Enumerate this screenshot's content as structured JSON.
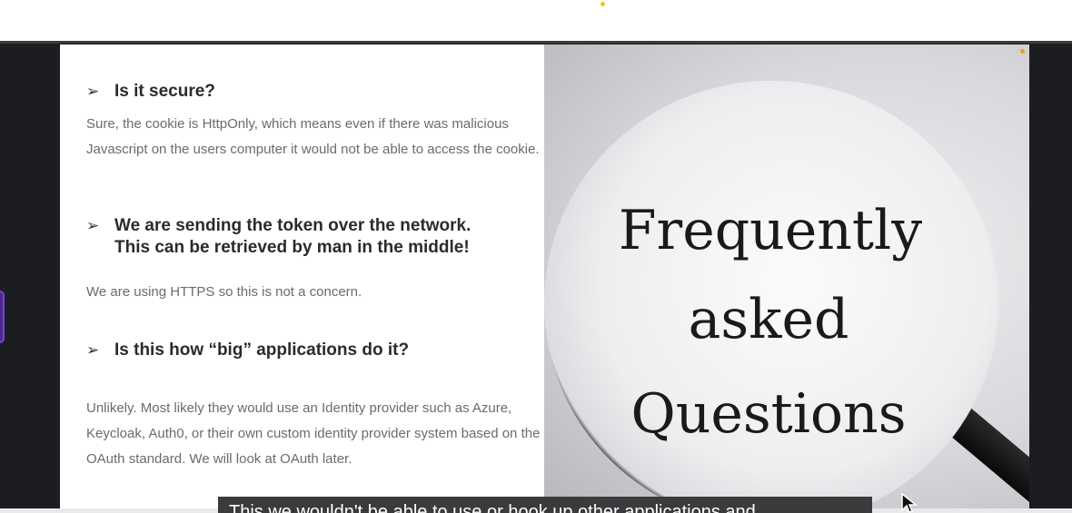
{
  "slide": {
    "faq": [
      {
        "question": "Is it secure?",
        "answer": "Sure, the cookie is HttpOnly, which means even if there was malicious Javascript on the users computer it would not be able to access the cookie."
      },
      {
        "question": "We are sending the token over the network.\nThis can be retrieved by man in the middle!",
        "answer": "We are using HTTPS so this is not a concern."
      },
      {
        "question": "Is this how “big” applications do it?",
        "answer": "Unlikely.  Most likely they would use an Identity provider such as Azure, Keycloak, Auth0, or their own custom identity provider system based on the OAuth standard.   We will look at OAuth later."
      }
    ],
    "bullet_glyph": "➢",
    "image": {
      "line1": "Frequently",
      "line2": "asked",
      "line3": "Questions"
    }
  },
  "subtitle": "This we wouldn't be able to use or hook up other applications and",
  "colors": {
    "loading_dot": "#f5c21a",
    "side_tab_accent": "#7b3fe4",
    "caption_bg": "#3b3b3e"
  }
}
